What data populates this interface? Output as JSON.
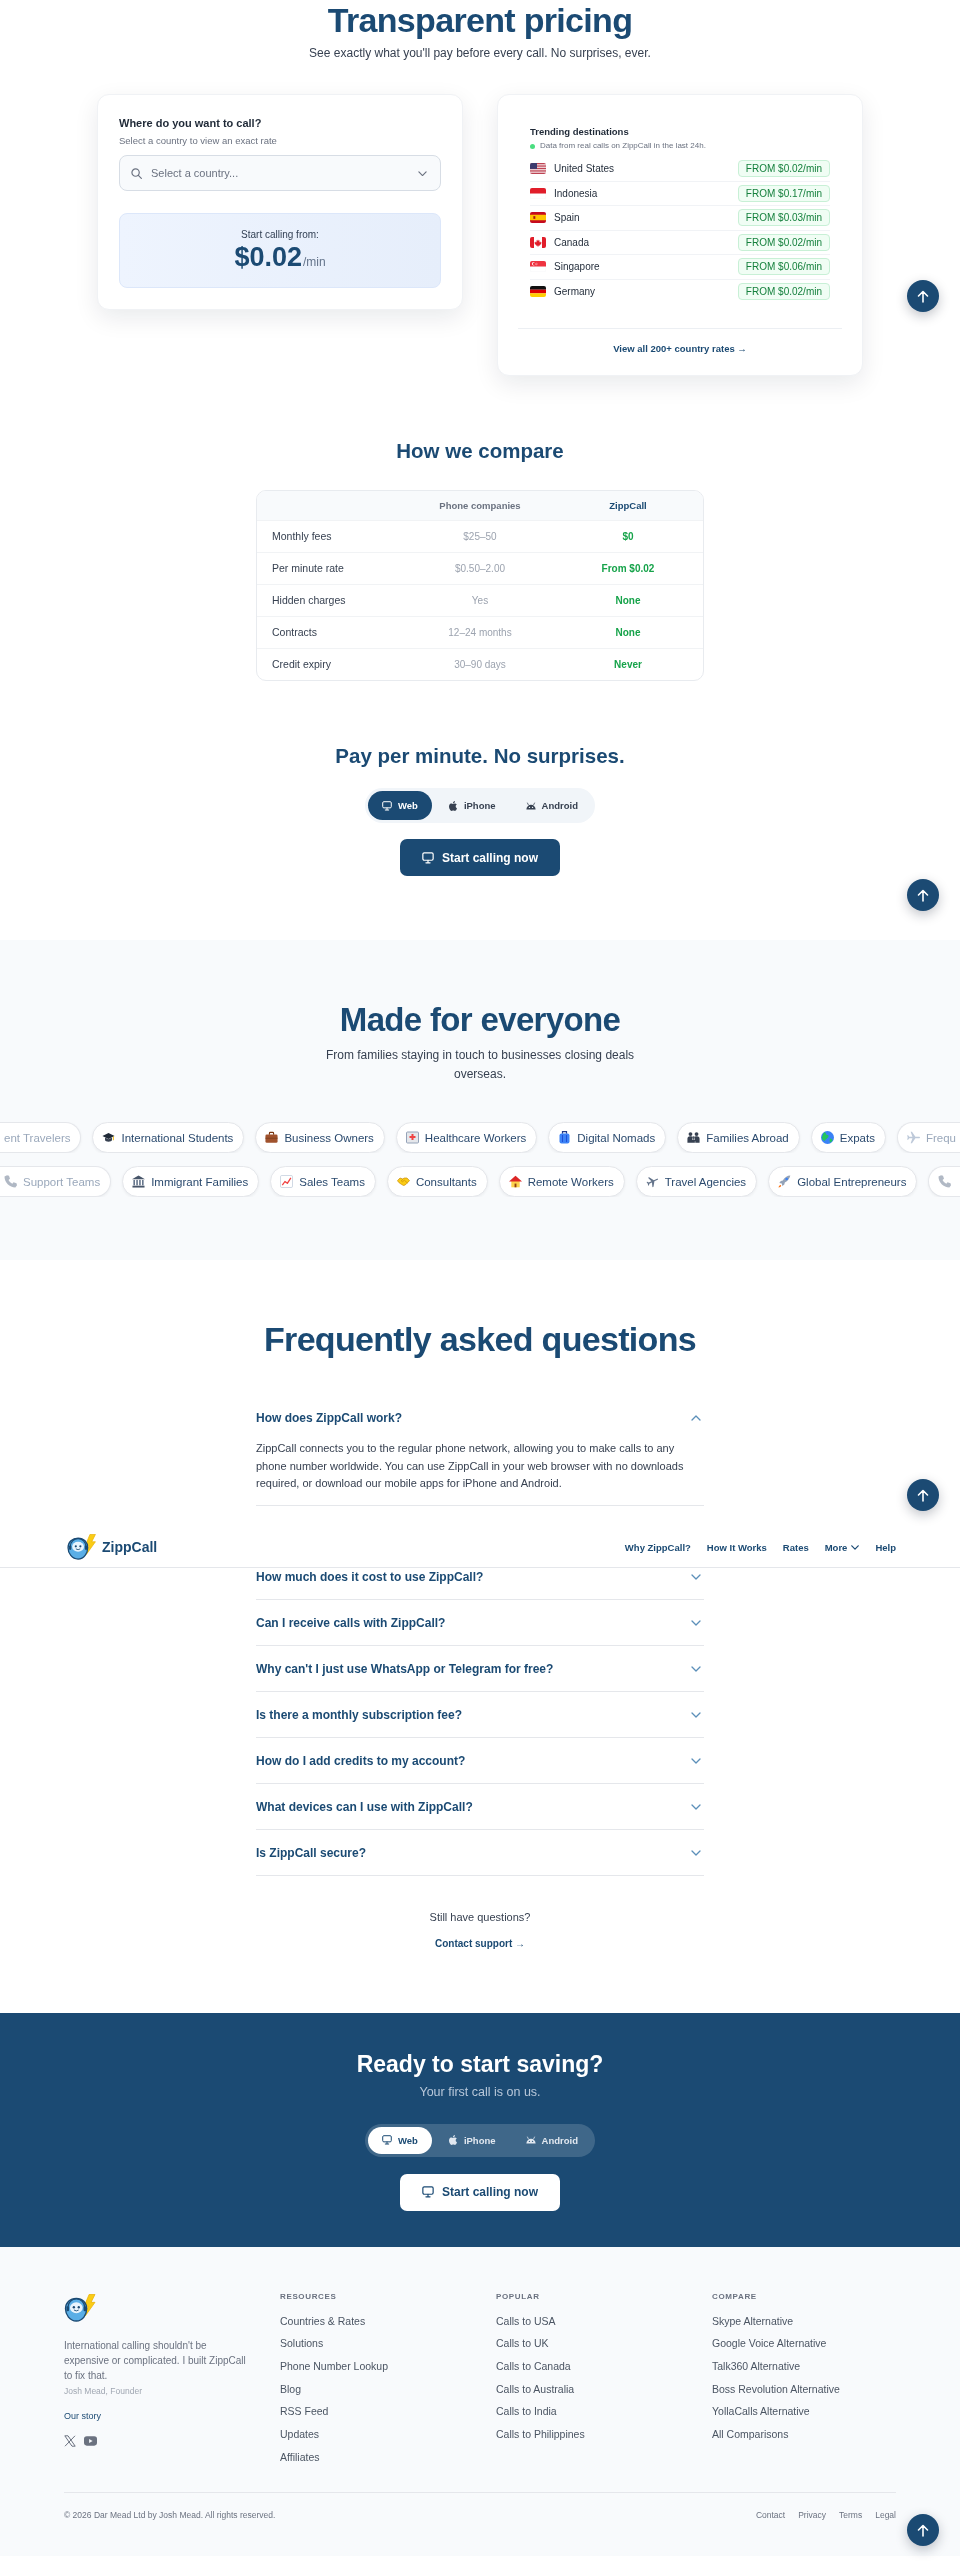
{
  "header": {
    "brand": "ZippCall",
    "nav": [
      {
        "kind": "link",
        "label": "Why ZippCall?"
      },
      {
        "kind": "link",
        "label": "How It Works"
      },
      {
        "kind": "link",
        "label": "Rates"
      },
      {
        "kind": "menu",
        "label": "More"
      },
      {
        "kind": "link",
        "label": "Help"
      }
    ]
  },
  "pricing": {
    "title": "Transparent pricing",
    "subtitle": "See exactly what you'll pay before every call. No surprises, ever.",
    "calculator": {
      "heading": "Where do you want to call?",
      "hint": "Select a country to view an exact rate",
      "placeholder": "Select a country...",
      "price_label": "Start calling from:",
      "price": "$0.02",
      "unit": "/min"
    },
    "trending": {
      "heading": "Trending destinations",
      "note": "Data from real calls on ZippCall in the last 24h.",
      "rows": [
        {
          "kind": "us",
          "country": "United States",
          "rate": "FROM $0.02/min"
        },
        {
          "kind": "id",
          "country": "Indonesia",
          "rate": "FROM $0.17/min"
        },
        {
          "kind": "es",
          "country": "Spain",
          "rate": "FROM $0.03/min"
        },
        {
          "kind": "ca",
          "country": "Canada",
          "rate": "FROM $0.02/min"
        },
        {
          "kind": "sg",
          "country": "Singapore",
          "rate": "FROM $0.06/min"
        },
        {
          "kind": "de",
          "country": "Germany",
          "rate": "FROM $0.02/min"
        }
      ],
      "link": "View all 200+ country rates →"
    }
  },
  "compare": {
    "title": "How we compare",
    "columns": [
      "Phone companies",
      "ZippCall"
    ],
    "rows": [
      {
        "feature": "Monthly fees",
        "phone": "$25–50",
        "zippcall": "$0"
      },
      {
        "feature": "Per minute rate",
        "phone": "$0.50–2.00",
        "zippcall": "From $0.02"
      },
      {
        "feature": "Hidden charges",
        "phone": "Yes",
        "zippcall": "None"
      },
      {
        "feature": "Contracts",
        "phone": "12–24 months",
        "zippcall": "None"
      },
      {
        "feature": "Credit expiry",
        "phone": "30–90 days",
        "zippcall": "Never"
      }
    ]
  },
  "get_started": {
    "title": "Pay per minute. No surprises.",
    "tabs": [
      {
        "kind": "web",
        "label": "Web",
        "selected": true
      },
      {
        "kind": "ios",
        "label": "iPhone",
        "selected": false
      },
      {
        "kind": "android",
        "label": "Android",
        "selected": false
      }
    ],
    "button": "Start calling now"
  },
  "audience": {
    "title": "Made for everyone",
    "subtitle": "From families staying in touch to businesses closing deals overseas.",
    "rows": [
      {
        "chips": [
          {
            "label": "ent Travelers"
          },
          {
            "kind": "students",
            "label": "International Students"
          },
          {
            "kind": "business",
            "label": "Business Owners"
          },
          {
            "kind": "health",
            "label": "Healthcare Workers"
          },
          {
            "kind": "nomads",
            "label": "Digital Nomads"
          },
          {
            "kind": "family",
            "label": "Families Abroad"
          },
          {
            "kind": "expats",
            "label": "Expats"
          },
          {
            "kind": "travel",
            "label": "Frequ"
          }
        ]
      },
      {
        "chips": [
          {
            "kind": "support",
            "label": "Support Teams"
          },
          {
            "kind": "immigrants",
            "label": "Immigrant Families"
          },
          {
            "kind": "sales",
            "label": "Sales Teams"
          },
          {
            "kind": "consultants",
            "label": "Consultants"
          },
          {
            "kind": "remote",
            "label": "Remote Workers"
          },
          {
            "kind": "agencies",
            "label": "Travel Agencies"
          },
          {
            "kind": "entrepreneurs",
            "label": "Global Entrepreneurs"
          },
          {
            "kind": "support"
          }
        ]
      }
    ]
  },
  "faq": {
    "title": "Frequently asked questions",
    "items": [
      {
        "question": "How does ZippCall work?",
        "expanded": true,
        "answer": "ZippCall connects you to the regular phone network, allowing you to make calls to any phone number worldwide. You can use ZippCall in your web browser with no downloads required, or download our mobile apps for iPhone and Android."
      },
      {
        "question": "How much does it cost to use ZippCall?",
        "expanded": false
      },
      {
        "question": "Can I receive calls with ZippCall?",
        "expanded": false
      },
      {
        "question": "Why can't I just use WhatsApp or Telegram for free?",
        "expanded": false
      },
      {
        "question": "Is there a monthly subscription fee?",
        "expanded": false
      },
      {
        "question": "How do I add credits to my account?",
        "expanded": false
      },
      {
        "question": "What devices can I use with ZippCall?",
        "expanded": false
      },
      {
        "question": "Is ZippCall secure?",
        "expanded": false
      }
    ],
    "still": "Still have questions?",
    "link": "Contact support →"
  },
  "cta": {
    "title": "Ready to start saving?",
    "subtitle": "Your first call is on us.",
    "tabs": [
      {
        "kind": "web",
        "label": "Web",
        "selected": true
      },
      {
        "kind": "ios",
        "label": "iPhone",
        "selected": false
      },
      {
        "kind": "android",
        "label": "Android",
        "selected": false
      }
    ],
    "button": "Start calling now"
  },
  "footer": {
    "tagline": "International calling shouldn't be expensive or complicated. I built ZippCall to fix that.",
    "author": "Josh Mead, Founder",
    "story_link": "Our story",
    "columns": [
      {
        "heading": "RESOURCES",
        "links": [
          "Countries & Rates",
          "Solutions",
          "Phone Number Lookup",
          "Blog",
          "RSS Feed",
          "Updates",
          "Affiliates"
        ]
      },
      {
        "heading": "POPULAR",
        "links": [
          "Calls to USA",
          "Calls to UK",
          "Calls to Canada",
          "Calls to Australia",
          "Calls to India",
          "Calls to Philippines"
        ]
      },
      {
        "heading": "COMPARE",
        "links": [
          "Skype Alternative",
          "Google Voice Alternative",
          "Talk360 Alternative",
          "Boss Revolution Alternative",
          "YollaCalls Alternative",
          "All Comparisons"
        ]
      }
    ],
    "copyright": "© 2026 Dar Mead Ltd by Josh Mead. All rights reserved.",
    "legal_links": [
      "Contact",
      "Privacy",
      "Terms",
      "Legal"
    ]
  }
}
